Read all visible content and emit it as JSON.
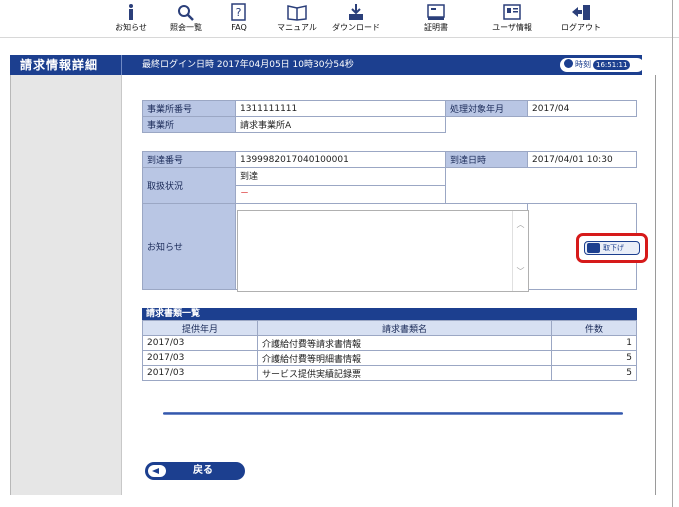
{
  "toolbar": {
    "items": [
      {
        "label": "お知らせ",
        "icon": "info-icon"
      },
      {
        "label": "照会一覧",
        "icon": "search-icon"
      },
      {
        "label": "FAQ",
        "icon": "question-icon"
      },
      {
        "label": "マニュアル",
        "icon": "book-icon"
      },
      {
        "label": "ダウンロード",
        "icon": "download-icon"
      },
      {
        "label": "証明書",
        "icon": "certificate-icon"
      },
      {
        "label": "ユーザ情報",
        "icon": "user-card-icon"
      },
      {
        "label": "ログアウト",
        "icon": "logout-icon"
      }
    ]
  },
  "header": {
    "title": "請求情報詳細",
    "last_login": "最終ログイン日時 2017年04月05日 10時30分54秒",
    "clock_label": "時刻",
    "clock_time": "16:51:11"
  },
  "info1": {
    "office_no_label": "事業所番号",
    "office_no": "1311111111",
    "period_label": "処理対象年月",
    "period": "2017/04",
    "office_label": "事業所",
    "office": "請求事業所A"
  },
  "info2": {
    "arrival_no_label": "到達番号",
    "arrival_no": "1399982017040100001",
    "arrival_dt_label": "到達日時",
    "arrival_dt": "2017/04/01 10:30",
    "status_label": "取扱状況",
    "status": "到達",
    "status_sub": "－",
    "notice_label": "お知らせ"
  },
  "withdraw_label": "取下げ",
  "list": {
    "title": "請求書類一覧",
    "headers": [
      "提供年月",
      "請求書類名",
      "件数"
    ],
    "rows": [
      {
        "month": "2017/03",
        "name": "介護給付費等請求書情報",
        "count": "1"
      },
      {
        "month": "2017/03",
        "name": "介護給付費等明細書情報",
        "count": "5"
      },
      {
        "month": "2017/03",
        "name": "サービス提供実績記録票",
        "count": "5"
      }
    ]
  },
  "back_label": "戻る",
  "colors": {
    "brand": "#1c3f8f",
    "highlight": "#d61a1a",
    "header_cell": "#b9c6e4"
  }
}
